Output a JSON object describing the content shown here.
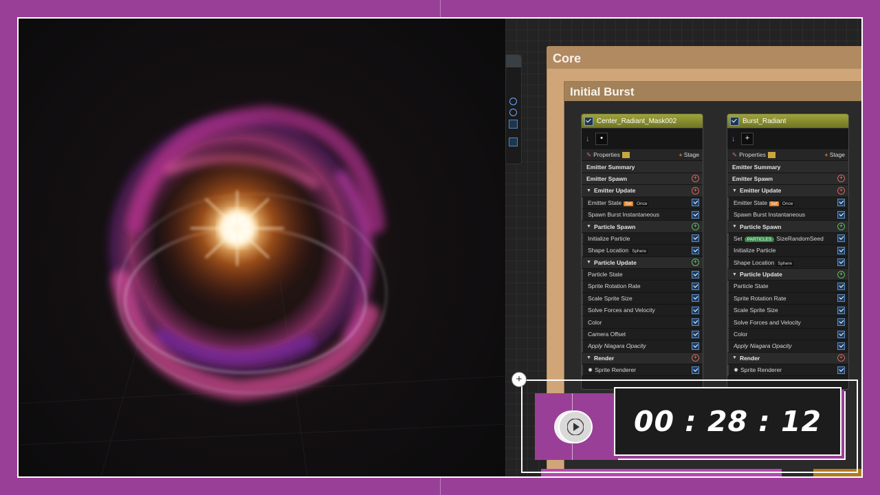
{
  "core": {
    "title": "Core"
  },
  "group": {
    "title": "Initial Burst"
  },
  "emitters": [
    {
      "name": "Center_Radiant_Mask002",
      "rows": [
        {
          "type": "props",
          "label": "Properties",
          "stage": "Stage"
        },
        {
          "type": "sec",
          "label": "Emitter Summary"
        },
        {
          "type": "sec",
          "label": "Emitter Spawn",
          "add": "r"
        },
        {
          "type": "sec",
          "label": "Emitter Update",
          "add": "r",
          "tri": true
        },
        {
          "type": "item",
          "label": "Emitter State",
          "set": "Set",
          "once": "Once"
        },
        {
          "type": "item",
          "label": "Spawn Burst Instantaneous"
        },
        {
          "type": "sec",
          "label": "Particle Spawn",
          "add": "g",
          "tri": true
        },
        {
          "type": "item",
          "label": "Initialize Particle"
        },
        {
          "type": "item",
          "label": "Shape Location",
          "sphere": "Sphere"
        },
        {
          "type": "sec",
          "label": "Particle Update",
          "add": "g",
          "tri": true
        },
        {
          "type": "item",
          "label": "Particle State"
        },
        {
          "type": "item",
          "label": "Sprite Rotation Rate"
        },
        {
          "type": "item",
          "label": "Scale Sprite Size"
        },
        {
          "type": "item",
          "label": "Solve Forces and Velocity"
        },
        {
          "type": "item",
          "label": "Color"
        },
        {
          "type": "item",
          "label": "Camera Offset"
        },
        {
          "type": "item",
          "label": "Apply Niagara Opacity",
          "italic": true
        },
        {
          "type": "sec",
          "label": "Render",
          "add": "r",
          "tri": true
        },
        {
          "type": "item",
          "label": "Sprite Renderer",
          "star": true
        }
      ]
    },
    {
      "name": "Burst_Radiant",
      "rows": [
        {
          "type": "props",
          "label": "Properties",
          "stage": "Stage"
        },
        {
          "type": "sec",
          "label": "Emitter Summary"
        },
        {
          "type": "sec",
          "label": "Emitter Spawn",
          "add": "r"
        },
        {
          "type": "sec",
          "label": "Emitter Update",
          "add": "r",
          "tri": true
        },
        {
          "type": "item",
          "label": "Emitter State",
          "set": "Set",
          "once": "Once"
        },
        {
          "type": "item",
          "label": "Spawn Burst Instantaneous"
        },
        {
          "type": "sec",
          "label": "Particle Spawn",
          "add": "g",
          "tri": true
        },
        {
          "type": "item",
          "label": "Set",
          "particles": "PARTICLES",
          "extra": "SizeRandomSeed"
        },
        {
          "type": "item",
          "label": "Initialize Particle"
        },
        {
          "type": "item",
          "label": "Shape Location",
          "sphere": "Sphere"
        },
        {
          "type": "sec",
          "label": "Particle Update",
          "add": "g",
          "tri": true
        },
        {
          "type": "item",
          "label": "Particle State"
        },
        {
          "type": "item",
          "label": "Sprite Rotation Rate"
        },
        {
          "type": "item",
          "label": "Scale Sprite Size"
        },
        {
          "type": "item",
          "label": "Solve Forces and Velocity"
        },
        {
          "type": "item",
          "label": "Color"
        },
        {
          "type": "item",
          "label": "Apply Niagara Opacity",
          "italic": true
        },
        {
          "type": "sec",
          "label": "Render",
          "add": "r",
          "tri": true
        },
        {
          "type": "item",
          "label": "Sprite Renderer",
          "star": true
        }
      ]
    }
  ],
  "timer": {
    "display": "00 : 28 : 12"
  },
  "icons": {
    "play": "play-icon",
    "add": "plus-icon",
    "check": "checkbox-icon"
  },
  "colors": {
    "background": "#9a3f97",
    "core_comment": "#d0a679",
    "emitter_header": "#9fa43a",
    "glow_core": "#ffd9a0",
    "glow_magenta": "#c2359e"
  }
}
